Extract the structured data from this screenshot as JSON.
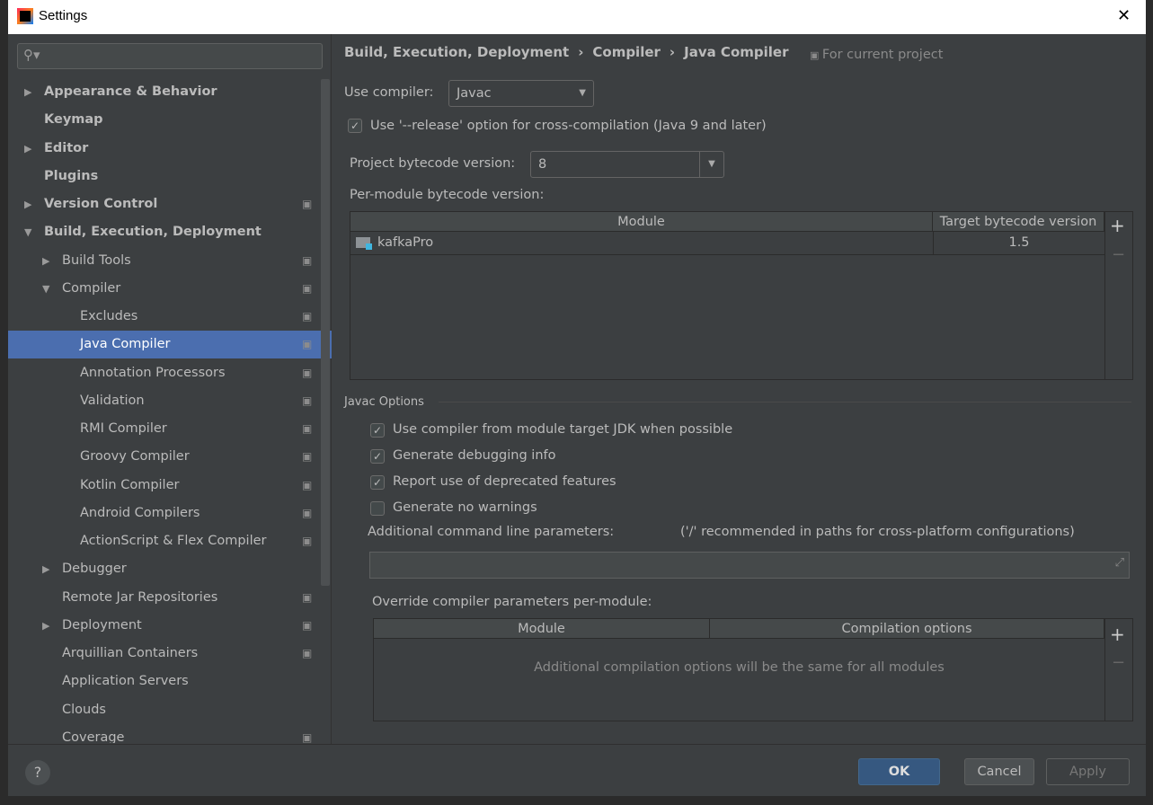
{
  "window": {
    "title": "Settings",
    "close": "✕"
  },
  "search": {
    "placeholder": ""
  },
  "sidebar": {
    "items": [
      {
        "label": "Appearance & Behavior",
        "level": 0,
        "arrow": "right",
        "cfg": false
      },
      {
        "label": "Keymap",
        "level": 0,
        "arrow": "",
        "cfg": false
      },
      {
        "label": "Editor",
        "level": 0,
        "arrow": "right",
        "cfg": false
      },
      {
        "label": "Plugins",
        "level": 0,
        "arrow": "",
        "cfg": false
      },
      {
        "label": "Version Control",
        "level": 0,
        "arrow": "right",
        "cfg": true
      },
      {
        "label": "Build, Execution, Deployment",
        "level": 0,
        "arrow": "down",
        "cfg": false
      },
      {
        "label": "Build Tools",
        "level": 1,
        "arrow": "right",
        "cfg": true
      },
      {
        "label": "Compiler",
        "level": 1,
        "arrow": "down",
        "cfg": true
      },
      {
        "label": "Excludes",
        "level": 2,
        "arrow": "",
        "cfg": true
      },
      {
        "label": "Java Compiler",
        "level": 2,
        "arrow": "",
        "cfg": true,
        "selected": true
      },
      {
        "label": "Annotation Processors",
        "level": 2,
        "arrow": "",
        "cfg": true
      },
      {
        "label": "Validation",
        "level": 2,
        "arrow": "",
        "cfg": true
      },
      {
        "label": "RMI Compiler",
        "level": 2,
        "arrow": "",
        "cfg": true
      },
      {
        "label": "Groovy Compiler",
        "level": 2,
        "arrow": "",
        "cfg": true
      },
      {
        "label": "Kotlin Compiler",
        "level": 2,
        "arrow": "",
        "cfg": true
      },
      {
        "label": "Android Compilers",
        "level": 2,
        "arrow": "",
        "cfg": true
      },
      {
        "label": "ActionScript & Flex Compiler",
        "level": 2,
        "arrow": "",
        "cfg": true
      },
      {
        "label": "Debugger",
        "level": 1,
        "arrow": "right",
        "cfg": false
      },
      {
        "label": "Remote Jar Repositories",
        "level": 1,
        "arrow": "",
        "cfg": true
      },
      {
        "label": "Deployment",
        "level": 1,
        "arrow": "right",
        "cfg": true
      },
      {
        "label": "Arquillian Containers",
        "level": 1,
        "arrow": "",
        "cfg": true
      },
      {
        "label": "Application Servers",
        "level": 1,
        "arrow": "",
        "cfg": false
      },
      {
        "label": "Clouds",
        "level": 1,
        "arrow": "",
        "cfg": false
      },
      {
        "label": "Coverage",
        "level": 1,
        "arrow": "",
        "cfg": true
      }
    ]
  },
  "breadcrumb": [
    "Build, Execution, Deployment",
    "Compiler",
    "Java Compiler"
  ],
  "scope": "For current project",
  "compiler": {
    "label": "Use compiler:",
    "value": "Javac"
  },
  "release_option": {
    "label": "Use '--release' option for cross-compilation (Java 9 and later)",
    "checked": true
  },
  "bytecode": {
    "label": "Project bytecode version:",
    "value": "8"
  },
  "per_module": {
    "label": "Per-module bytecode version:",
    "columns": [
      "Module",
      "Target bytecode version"
    ],
    "rows": [
      {
        "module": "kafkaPro",
        "version": "1.5"
      }
    ]
  },
  "javac": {
    "section": "Javac Options",
    "options": [
      {
        "label": "Use compiler from module target JDK when possible",
        "checked": true
      },
      {
        "label": "Generate debugging info",
        "checked": true
      },
      {
        "label": "Report use of deprecated features",
        "checked": true
      },
      {
        "label": "Generate no warnings",
        "checked": false
      }
    ],
    "cmd_label": "Additional command line parameters:",
    "cmd_hint": "('/' recommended in paths for cross-platform configurations)",
    "cmd_value": ""
  },
  "override": {
    "label": "Override compiler parameters per-module:",
    "columns": [
      "Module",
      "Compilation options"
    ],
    "empty": "Additional compilation options will be the same for all modules"
  },
  "buttons": {
    "ok": "OK",
    "cancel": "Cancel",
    "apply": "Apply",
    "help": "?",
    "add": "+",
    "remove": "−"
  },
  "colors": {
    "selection": "#4b6eaf",
    "ok": "#365880",
    "bg": "#3c3f41"
  }
}
